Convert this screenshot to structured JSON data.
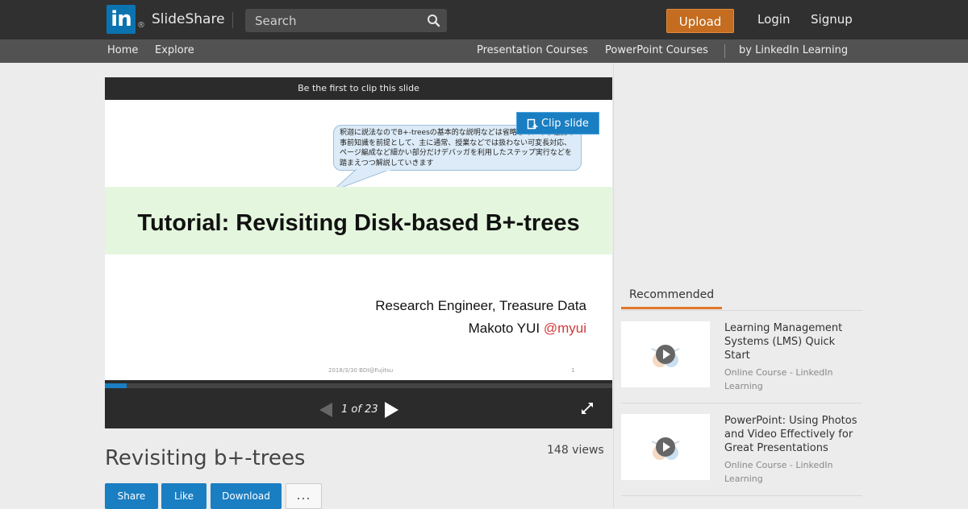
{
  "header": {
    "logo_letters": "in",
    "logo_reg": "®",
    "brand": "SlideShare",
    "search_placeholder": "Search",
    "upload": "Upload",
    "login": "Login",
    "signup": "Signup"
  },
  "subnav": {
    "home": "Home",
    "explore": "Explore",
    "presentation_courses": "Presentation Courses",
    "powerpoint_courses": "PowerPoint Courses",
    "linkedin_learning": "by LinkedIn Learning"
  },
  "player": {
    "clip_prompt": "Be the first to clip this slide",
    "clip_button": "Clip slide",
    "pager": "1 of 23",
    "current_page": 1,
    "total_pages": 23,
    "progress_fraction": 0.043
  },
  "slide": {
    "bubble_text": "釈迦に説法なのでB+-treesの基本的な説明などは省略して、ある程度の事前知識を前提として、主に通常、授業などでは扱わない可変長対応、ページ編成など細かい部分だけデバッガを利用したステップ実行などを踏まえつつ解説していきます",
    "title": "Tutorial: Revisiting Disk-based B+-trees",
    "author_role": "Research Engineer, Treasure Data",
    "author_name": "Makoto YUI",
    "author_handle": "@myui",
    "footer": "2018/3/30 BDI@Fujitsu",
    "page_number": "1"
  },
  "document": {
    "title": "Revisiting b+-trees",
    "views": "148 views",
    "actions": [
      "Share",
      "Like",
      "Download",
      "..."
    ]
  },
  "recommended": {
    "header": "Recommended",
    "items": [
      {
        "title": "Learning Management Systems (LMS) Quick Start",
        "source": "Online Course - LinkedIn Learning"
      },
      {
        "title": "PowerPoint: Using Photos and Video Effectively for Great Presentations",
        "source": "Online Course - LinkedIn Learning"
      }
    ]
  },
  "colors": {
    "topbar": "#303030",
    "subbar": "#525252",
    "upload": "#c46c20",
    "accent_blue": "#1a7ec2",
    "recommended_underline": "#e0782a",
    "slide_band": "#e4f7de",
    "handle_red": "#d23a3a"
  },
  "icons": {
    "search": "search-icon",
    "clip": "clip-icon",
    "prev": "prev-arrow-icon",
    "next": "next-arrow-icon",
    "fullscreen": "fullscreen-icon",
    "play": "play-icon"
  }
}
